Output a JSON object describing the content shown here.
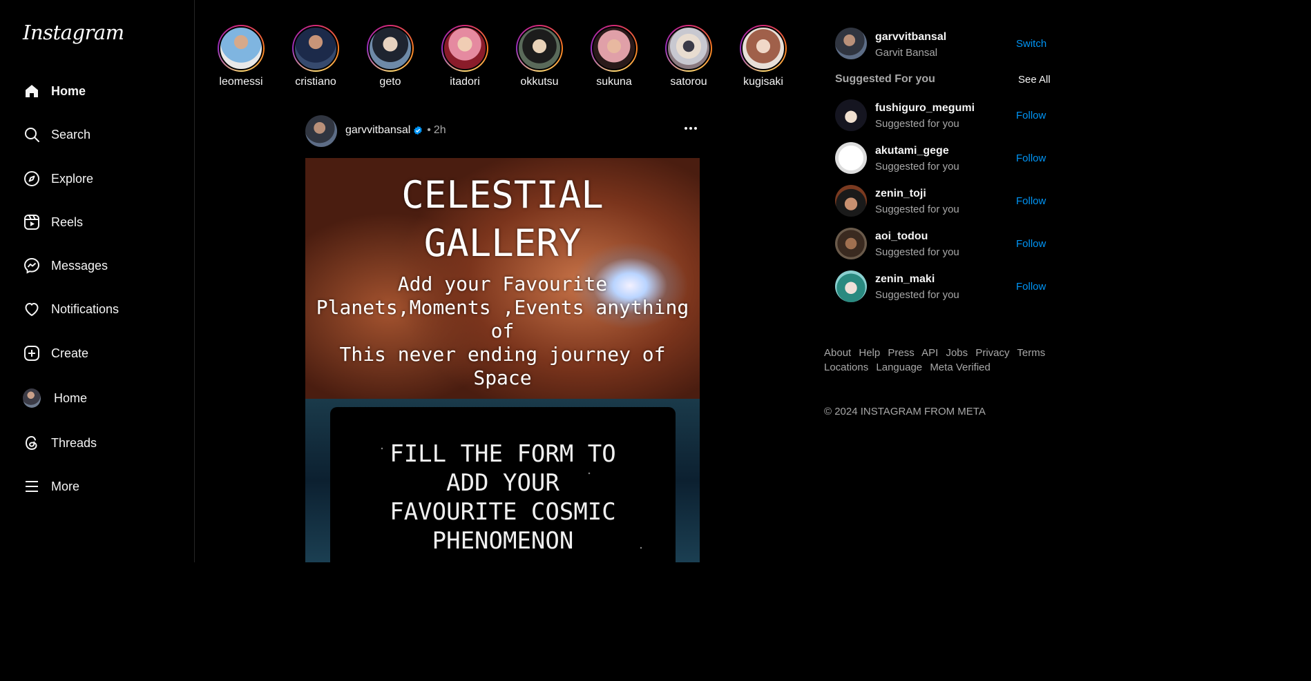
{
  "app": {
    "logo": "Instagram"
  },
  "sidebar": {
    "items": [
      {
        "label": "Home",
        "icon": "home-icon"
      },
      {
        "label": "Search",
        "icon": "search-icon"
      },
      {
        "label": "Explore",
        "icon": "compass-icon"
      },
      {
        "label": "Reels",
        "icon": "reels-icon"
      },
      {
        "label": "Messages",
        "icon": "messenger-icon"
      },
      {
        "label": "Notifications",
        "icon": "heart-icon"
      },
      {
        "label": "Create",
        "icon": "plus-square-icon"
      },
      {
        "label": "Home",
        "icon": "profile-avatar"
      },
      {
        "label": "Threads",
        "icon": "threads-icon"
      },
      {
        "label": "More",
        "icon": "menu-icon"
      }
    ]
  },
  "stories": [
    {
      "name": "leomessi"
    },
    {
      "name": "cristiano"
    },
    {
      "name": "geto"
    },
    {
      "name": "itadori"
    },
    {
      "name": "okkutsu"
    },
    {
      "name": "sukuna"
    },
    {
      "name": "satorou"
    },
    {
      "name": "kugisaki"
    }
  ],
  "post": {
    "username": "garvvitbansal",
    "separator": "•",
    "time": "2h",
    "image_title_line1": "CELESTIAL",
    "image_title_line2": "GALLERY",
    "image_text_lines": [
      "Add your Favourite",
      "Planets,Moments ,Events anything",
      "of",
      "This never ending journey of",
      "Space"
    ],
    "form_lines": [
      "FILL THE FORM TO",
      "ADD YOUR",
      "FAVOURITE COSMIC",
      "PHENOMENON"
    ]
  },
  "account": {
    "username": "garvvitbansal",
    "full_name": "Garvit Bansal",
    "switch_label": "Switch"
  },
  "suggestions": {
    "heading": "Suggested For you",
    "see_all": "See All",
    "items": [
      {
        "username": "fushiguro_megumi",
        "sub": "Suggested for you",
        "action": "Follow"
      },
      {
        "username": "akutami_gege",
        "sub": "Suggested for you",
        "action": "Follow"
      },
      {
        "username": "zenin_toji",
        "sub": "Suggested for you",
        "action": "Follow"
      },
      {
        "username": "aoi_todou",
        "sub": "Suggested for you",
        "action": "Follow"
      },
      {
        "username": "zenin_maki",
        "sub": "Suggested for you",
        "action": "Follow"
      }
    ]
  },
  "footer": {
    "links": [
      "About",
      "Help",
      "Press",
      "API",
      "Jobs",
      "Privacy",
      "Terms",
      "Locations",
      "Language",
      "Meta Verified"
    ],
    "copyright": "© 2024 INSTAGRAM FROM META"
  },
  "colors": {
    "accent": "#0095f6",
    "background": "#000000",
    "muted": "#a8a8a8"
  }
}
